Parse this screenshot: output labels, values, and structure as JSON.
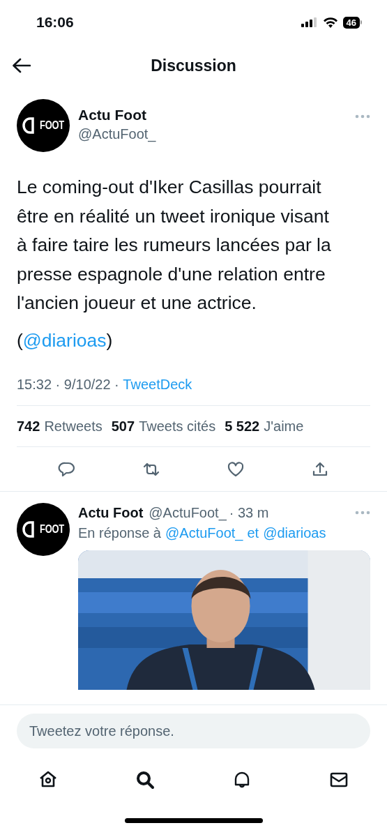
{
  "status_bar": {
    "time": "16:06",
    "battery": "46"
  },
  "header": {
    "title": "Discussion"
  },
  "tweet": {
    "author": {
      "name": "Actu Foot",
      "handle": "@ActuFoot_",
      "logo_text": "FOOT"
    },
    "text": "Le coming-out d'Iker Casillas pourrait être en réalité un tweet ironique visant à faire taire les rumeurs lancées par la presse espagnole d'une relation entre l'ancien joueur et une actrice.",
    "mention_line": [
      "(",
      "@diarioas",
      ")"
    ],
    "time": "15:32 · 9/10/22 · ",
    "source": "TweetDeck",
    "stats": [
      {
        "count": "742",
        "label": "Retweets"
      },
      {
        "count": "507",
        "label": "Tweets cités"
      },
      {
        "count": "5 522",
        "label": "J'aime"
      }
    ],
    "actions": [
      {
        "kind": "reply"
      },
      {
        "kind": "retweet"
      },
      {
        "kind": "like"
      },
      {
        "kind": "share"
      }
    ]
  },
  "reply": {
    "author": {
      "name": "Actu Foot",
      "handle": "@ActuFoot_",
      "logo_text": "FOOT"
    },
    "age": "· 33 m",
    "replying_to": {
      "prefix": "En réponse à",
      "mentions": [
        "@ActuFoot_",
        "et",
        "@diarioas"
      ]
    }
  },
  "composer": {
    "placeholder": "Tweetez votre réponse."
  },
  "nav": [
    {
      "kind": "home",
      "selected": false
    },
    {
      "kind": "search",
      "selected": true
    },
    {
      "kind": "notifications",
      "selected": false
    },
    {
      "kind": "messages",
      "selected": false
    }
  ]
}
